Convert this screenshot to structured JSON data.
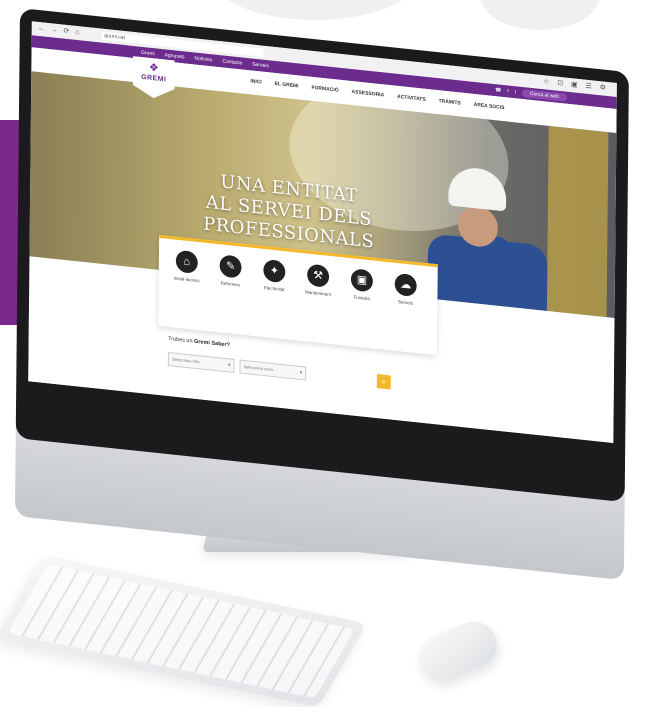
{
  "browser": {
    "url": "gremi.cat",
    "nav_glyphs": "← → ⟳ ⌂",
    "right_glyphs": "☆ ⊡ ▣ ☰ ⚙"
  },
  "topbar": {
    "links": [
      "Gremi",
      "Agrupats",
      "Notícies",
      "Contacte",
      "Serveis"
    ],
    "search_label": "Cerca al web",
    "accent_color": "#6b2c8e"
  },
  "logo": {
    "text": "GREMI"
  },
  "menu": [
    "INICI",
    "EL GREMI",
    "FORMACIÓ",
    "ASSESSORIA",
    "ACTIVITATS",
    "TRÀMITS",
    "ÀREA SOCIS"
  ],
  "hero": {
    "title_line1": "UNA ENTITAT",
    "title_line2": "AL SERVEI DELS PROFESSIONALS"
  },
  "categories": [
    {
      "label": "Instal·lacions",
      "icon": "house-icon"
    },
    {
      "label": "Reformes",
      "icon": "wrench-icon"
    },
    {
      "label": "Electricitat",
      "icon": "bulb-icon"
    },
    {
      "label": "Manteniment",
      "icon": "tool-icon"
    },
    {
      "label": "Fusteria",
      "icon": "box-icon"
    },
    {
      "label": "Serveis",
      "icon": "cloud-icon"
    }
  ],
  "search": {
    "title_prefix": "Trobes un",
    "title_bold": "Gremi Saber?",
    "select1": "Selecciona ofici",
    "select2": "Selecciona zona",
    "button_icon": "search-icon",
    "button_color": "#f4b928"
  }
}
